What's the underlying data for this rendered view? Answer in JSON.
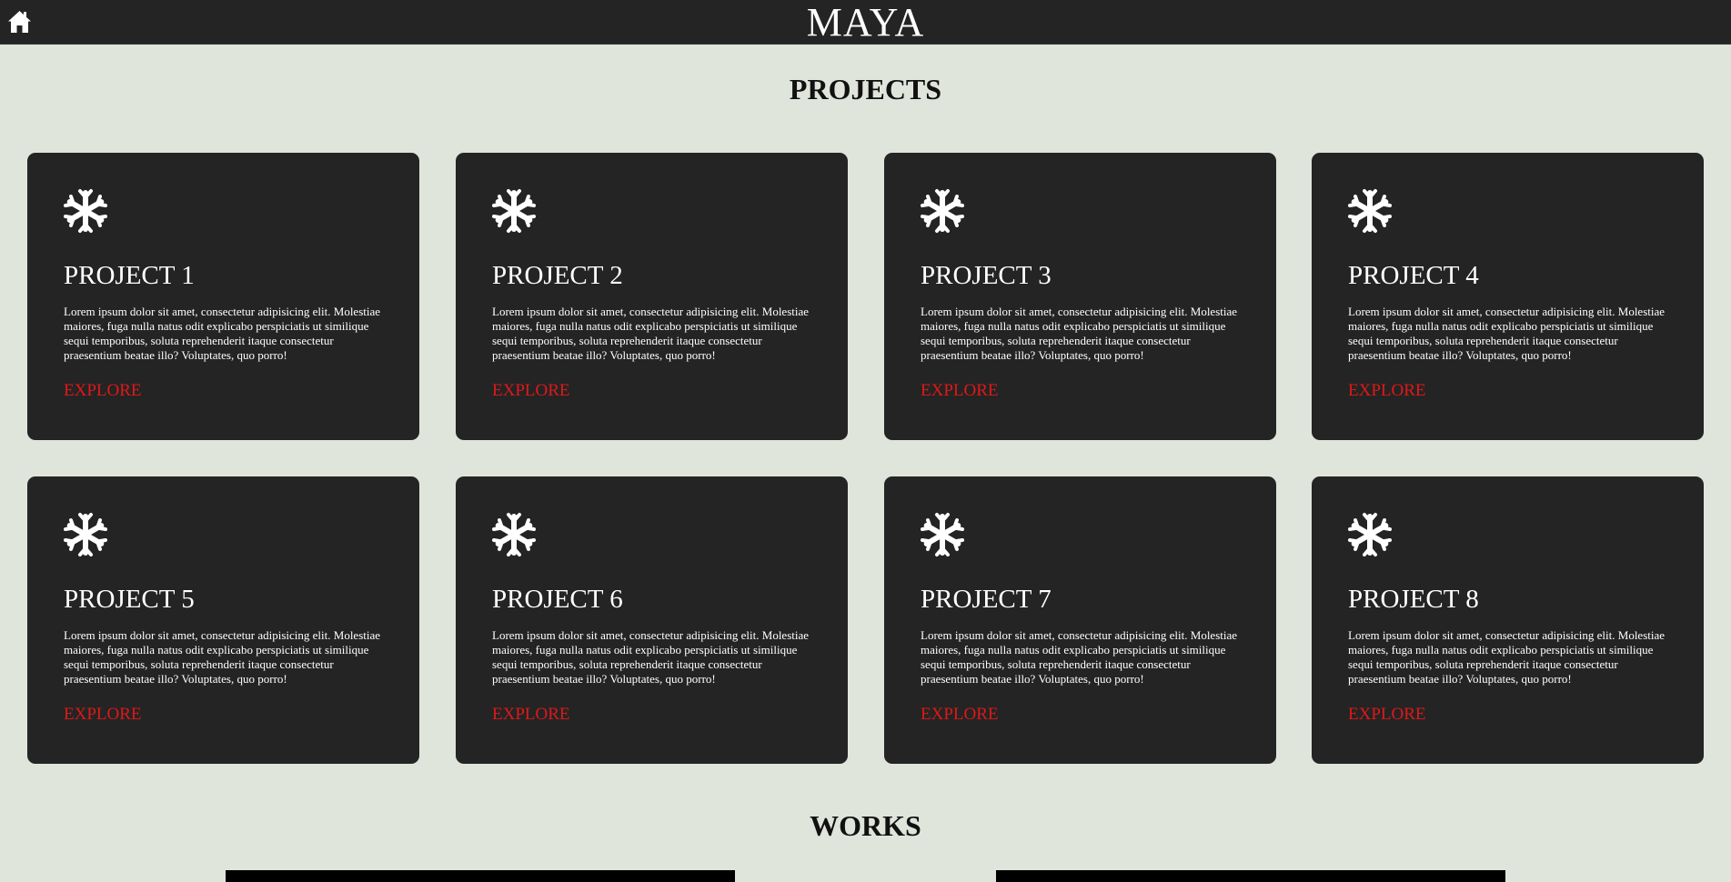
{
  "header": {
    "brand": "MAYA",
    "home_icon": "home-icon"
  },
  "projects": {
    "title": "PROJECTS",
    "cards": [
      {
        "title": "PROJECT 1",
        "text": "Lorem ipsum dolor sit amet, consectetur adipisicing elit. Molestiae maiores, fuga nulla natus odit explicabo perspiciatis ut similique sequi temporibus, soluta reprehenderit itaque consectetur praesentium beatae illo? Voluptates, quo porro!",
        "link": "EXPLORE",
        "icon": "snowflake-icon"
      },
      {
        "title": "PROJECT 2",
        "text": "Lorem ipsum dolor sit amet, consectetur adipisicing elit. Molestiae maiores, fuga nulla natus odit explicabo perspiciatis ut similique sequi temporibus, soluta reprehenderit itaque consectetur praesentium beatae illo? Voluptates, quo porro!",
        "link": "EXPLORE",
        "icon": "snowflake-icon"
      },
      {
        "title": "PROJECT 3",
        "text": "Lorem ipsum dolor sit amet, consectetur adipisicing elit. Molestiae maiores, fuga nulla natus odit explicabo perspiciatis ut similique sequi temporibus, soluta reprehenderit itaque consectetur praesentium beatae illo? Voluptates, quo porro!",
        "link": "EXPLORE",
        "icon": "snowflake-icon"
      },
      {
        "title": "PROJECT 4",
        "text": "Lorem ipsum dolor sit amet, consectetur adipisicing elit. Molestiae maiores, fuga nulla natus odit explicabo perspiciatis ut similique sequi temporibus, soluta reprehenderit itaque consectetur praesentium beatae illo? Voluptates, quo porro!",
        "link": "EXPLORE",
        "icon": "snowflake-icon"
      },
      {
        "title": "PROJECT 5",
        "text": "Lorem ipsum dolor sit amet, consectetur adipisicing elit. Molestiae maiores, fuga nulla natus odit explicabo perspiciatis ut similique sequi temporibus, soluta reprehenderit itaque consectetur praesentium beatae illo? Voluptates, quo porro!",
        "link": "EXPLORE",
        "icon": "snowflake-icon"
      },
      {
        "title": "PROJECT 6",
        "text": "Lorem ipsum dolor sit amet, consectetur adipisicing elit. Molestiae maiores, fuga nulla natus odit explicabo perspiciatis ut similique sequi temporibus, soluta reprehenderit itaque consectetur praesentium beatae illo? Voluptates, quo porro!",
        "link": "EXPLORE",
        "icon": "snowflake-icon"
      },
      {
        "title": "PROJECT 7",
        "text": "Lorem ipsum dolor sit amet, consectetur adipisicing elit. Molestiae maiores, fuga nulla natus odit explicabo perspiciatis ut similique sequi temporibus, soluta reprehenderit itaque consectetur praesentium beatae illo? Voluptates, quo porro!",
        "link": "EXPLORE",
        "icon": "snowflake-icon"
      },
      {
        "title": "PROJECT 8",
        "text": "Lorem ipsum dolor sit amet, consectetur adipisicing elit. Molestiae maiores, fuga nulla natus odit explicabo perspiciatis ut similique sequi temporibus, soluta reprehenderit itaque consectetur praesentium beatae illo? Voluptates, quo porro!",
        "link": "EXPLORE",
        "icon": "snowflake-icon"
      }
    ]
  },
  "works": {
    "title": "WORKS"
  },
  "colors": {
    "background": "#dfe5db",
    "card": "#242424",
    "accent": "#e01818",
    "text_light": "#ffffff"
  }
}
